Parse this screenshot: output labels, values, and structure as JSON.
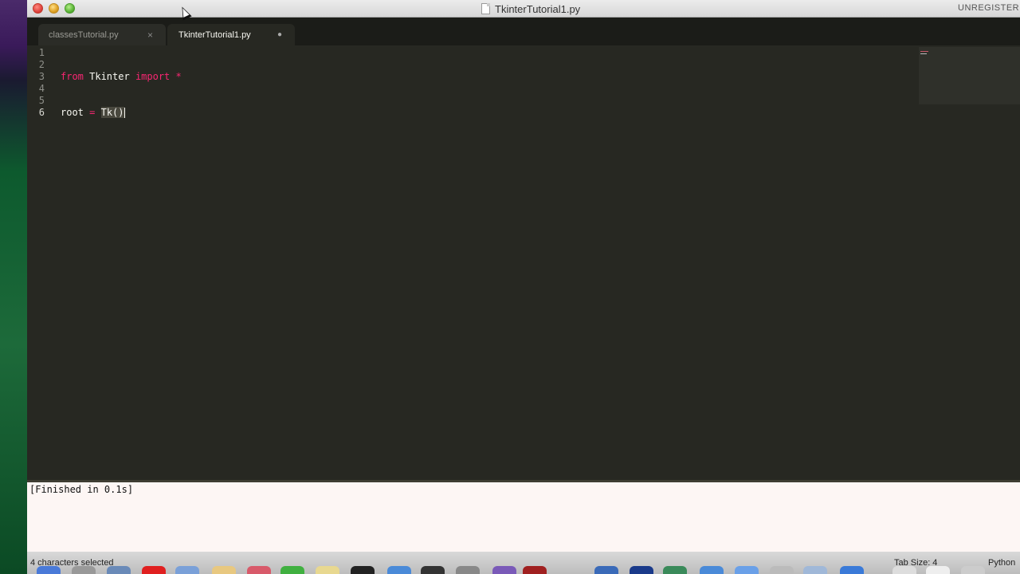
{
  "window": {
    "title": "TkinterTutorial1.py",
    "registration_notice": "UNREGISTERED"
  },
  "tabs": [
    {
      "label": "classesTutorial.py",
      "control": "×",
      "active": false
    },
    {
      "label": "TkinterTutorial1.py",
      "control": "●",
      "active": true
    }
  ],
  "editor": {
    "line_numbers": [
      "1",
      "2",
      "3",
      "4",
      "5",
      "6"
    ],
    "current_line": "6",
    "lines": {
      "l3": {
        "kw1": "from",
        "mod": " Tkinter ",
        "kw2": "import",
        "star": " *"
      },
      "l6": {
        "var": "root",
        "op": " = ",
        "call": "Tk()"
      }
    }
  },
  "output": {
    "text": "[Finished in 0.1s]"
  },
  "statusbar": {
    "selection": "4 characters selected",
    "tab_size": "Tab Size: 4",
    "syntax": "Python"
  },
  "colors": {
    "editor_bg": "#272822",
    "keyword": "#f92672",
    "text": "#f8f8f2",
    "gutter": "#8f908a"
  }
}
